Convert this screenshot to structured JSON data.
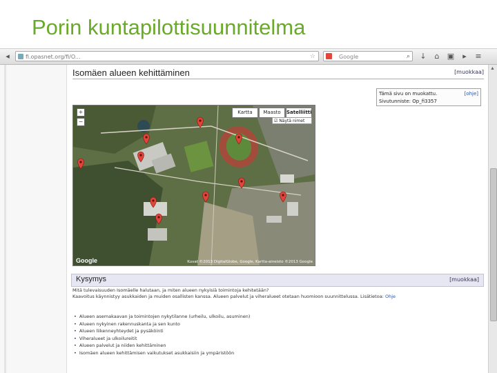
{
  "slide": {
    "title": "Porin kuntapilottisuunnitelma"
  },
  "browser": {
    "url": "fi.opasnet.org/fi/O...",
    "search_placeholder": "Google"
  },
  "page": {
    "heading": "Isomäen alueen kehittäminen",
    "edit_label": "[muokkaa]",
    "infobox": {
      "line1": "Tämä sivu on muokattu.",
      "line1_link": "[ohje]",
      "line2": "Sivutunniste: Op_fi3357"
    }
  },
  "map": {
    "buttons": [
      "Kartta",
      "Maasto",
      "Satelliitti"
    ],
    "active_button": "Satelliitti",
    "checkbox_label": "Näytä nimet",
    "zoom_plus": "+",
    "zoom_minus": "−",
    "copyright": "Kuvat ©2013 DigitalGlobe, Google, Kartta-aineisto ©2013 Google",
    "logo": "Google"
  },
  "section": {
    "title": "Kysymys",
    "edit_label": "[muokkaa]",
    "text1": "Mitä tulevaisuuden Isomäelle halutaan, ja miten alueen nykyisiä toimintoja kehitetään?",
    "text2": "Kaavoitus käynnistyy asukkaiden ja muiden osallisten kanssa. Alueen palvelut ja viheralueet otetaan huomioon suunnittelussa. Lisätietoa:",
    "text2_link": "Ohje",
    "bullets": [
      "Alueen asemakaavan ja toimintojen nykytilanne (urheilu, ulkoilu, asuminen)",
      "Alueen nykyinen rakennuskanta ja sen kunto",
      "Alueen liikenneyhteydet ja pysäköinti",
      "Viheralueet ja ulkoilureitit",
      "Alueen palvelut ja niiden kehittäminen",
      "Isomäen alueen kehittämisen vaikutukset asukkaisiin ja ympäristöön"
    ]
  },
  "colors": {
    "title_green": "#6aaa2a",
    "section_header_bg": "#e6e7f3",
    "map_marker": "#e0443a"
  }
}
